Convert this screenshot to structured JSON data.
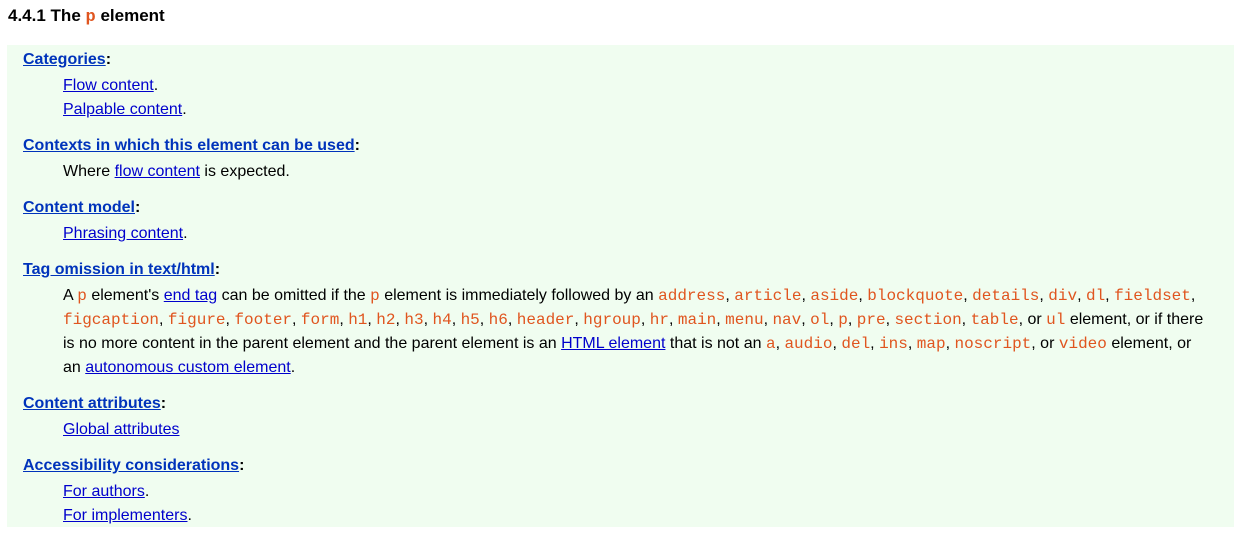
{
  "heading": {
    "number": "4.4.1",
    "the": "The",
    "tag": "p",
    "word": "element"
  },
  "sections": {
    "categories": {
      "title": "Categories",
      "items": [
        "Flow content",
        "Palpable content"
      ]
    },
    "contexts": {
      "title": "Contexts in which this element can be used",
      "prefix": "Where",
      "link": "flow content",
      "suffix": "is expected."
    },
    "content_model": {
      "title": "Content model",
      "item": "Phrasing content"
    },
    "tag_omission": {
      "title": "Tag omission in text/html",
      "t1": "A",
      "t2": "element's",
      "end_tag": "end tag",
      "t3": "can be omitted if the",
      "t4": "element is immediately followed by an",
      "elements": [
        "address",
        "article",
        "aside",
        "blockquote",
        "details",
        "div",
        "dl",
        "fieldset",
        "figcaption",
        "figure",
        "footer",
        "form",
        "h1",
        "h2",
        "h3",
        "h4",
        "h5",
        "h6",
        "header",
        "hgroup",
        "hr",
        "main",
        "menu",
        "nav",
        "ol",
        "p",
        "pre",
        "section",
        "table",
        "ul"
      ],
      "or": "or",
      "t5": "element, or if there is no more content in the parent element and the parent element is an",
      "html_element": "HTML element",
      "t6": "that is not an",
      "excluded": [
        "a",
        "audio",
        "del",
        "ins",
        "map",
        "noscript",
        "video"
      ],
      "t7": "element, or an",
      "custom_element": "autonomous custom element"
    },
    "attributes": {
      "title": "Content attributes",
      "item": "Global attributes"
    },
    "accessibility": {
      "title": "Accessibility considerations",
      "items": [
        "For authors",
        "For implementers"
      ]
    }
  }
}
